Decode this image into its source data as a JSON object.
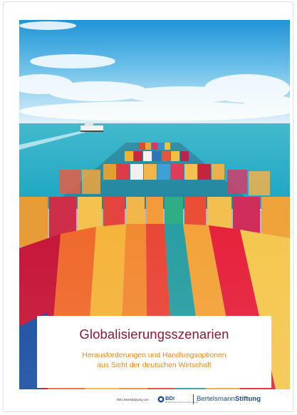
{
  "cover": {
    "title": "Globalisierungsszenarien",
    "subtitle_line1": "Herausforderungen und Handlungsoptionen",
    "subtitle_line2": "aus Sicht der deutschen Wirtschaft"
  },
  "footer": {
    "support_text": "Mit Unterstützung von",
    "partner_logo": "BDI",
    "partner_logo_subtext": "Bundesverband der Deutschen Industrie",
    "publisher_logo_regular": "Bertelsmann",
    "publisher_logo_bold": "Stiftung"
  },
  "colors": {
    "title": "#8e1736",
    "subtitle": "#e9871f",
    "publisher": "#1c4a84",
    "sky_top": "#2b9fd8",
    "sea": "#2fb8c8"
  }
}
